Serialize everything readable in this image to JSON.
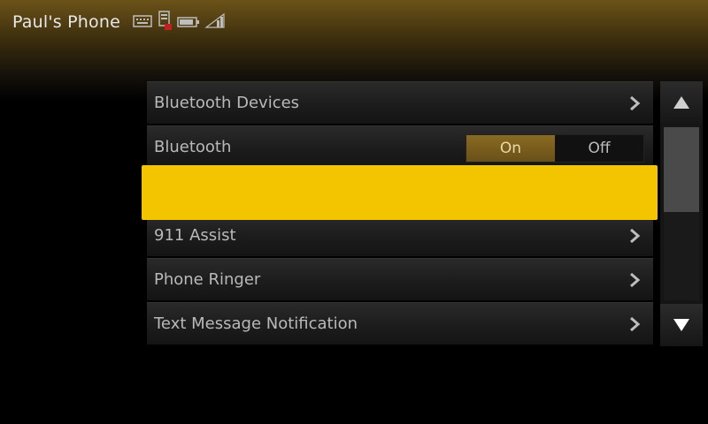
{
  "status_bar": {
    "phone_name": "Paul's Phone",
    "icons": [
      "keyboard-icon",
      "phonebook-icon",
      "battery-icon",
      "signal-icon"
    ]
  },
  "menu": {
    "items": [
      {
        "label": "Bluetooth Devices",
        "type": "link"
      },
      {
        "label": "Bluetooth",
        "type": "toggle",
        "options": [
          "On",
          "Off"
        ],
        "selected": "On"
      },
      {
        "label": "",
        "type": "highlighted"
      },
      {
        "label": "911 Assist",
        "type": "link"
      },
      {
        "label": "Phone Ringer",
        "type": "link"
      },
      {
        "label": "Text Message Notification",
        "type": "link"
      }
    ]
  },
  "scrollbar": {
    "up_label": "scroll-up",
    "down_label": "scroll-down"
  },
  "colors": {
    "highlight": "#f2c500",
    "accent": "#7a5c1c",
    "background": "#000000"
  }
}
